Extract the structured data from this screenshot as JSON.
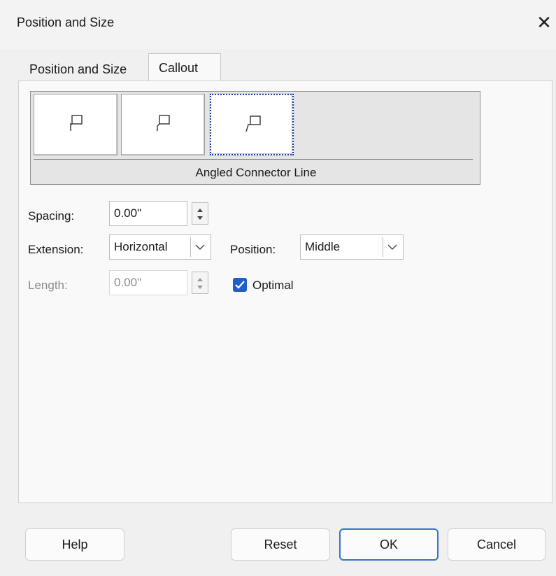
{
  "window": {
    "title": "Position and Size",
    "close_glyph": "✕"
  },
  "tabs": [
    {
      "label": "Position and Size"
    },
    {
      "label": "Callout"
    }
  ],
  "connector": {
    "options": [
      {
        "icon": "straight-connector-icon"
      },
      {
        "icon": "angled-connector-icon"
      },
      {
        "icon": "angled-connector-line-icon",
        "selected": true
      }
    ],
    "caption": "Angled Connector Line"
  },
  "form": {
    "spacing_label": "Spacing:",
    "spacing_value": "0.00\"",
    "extension_label": "Extension:",
    "extension_value": "Horizontal",
    "position_label": "Position:",
    "position_value": "Middle",
    "length_label": "Length:",
    "length_value": "0.00\"",
    "optimal_label": "Optimal",
    "optimal_checked": true
  },
  "buttons": {
    "help": "Help",
    "reset": "Reset",
    "ok": "OK",
    "cancel": "Cancel"
  },
  "colors": {
    "accent": "#1f5fc8",
    "selection_border": "#1b3e9a"
  }
}
